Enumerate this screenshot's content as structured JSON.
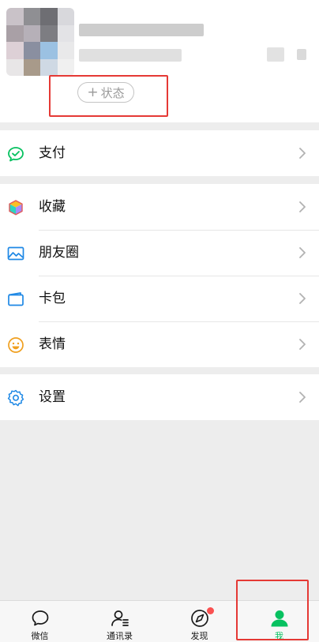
{
  "profile": {
    "status_plus": "+",
    "status_label": "状态"
  },
  "menu": {
    "pay_label": "支付",
    "favorites_label": "收藏",
    "moments_label": "朋友圈",
    "cards_label": "卡包",
    "stickers_label": "表情",
    "settings_label": "设置"
  },
  "tabs": [
    {
      "label": "微信",
      "icon": "chat-bubble-icon",
      "active": false
    },
    {
      "label": "通讯录",
      "icon": "contacts-icon",
      "active": false
    },
    {
      "label": "发现",
      "icon": "compass-icon",
      "active": false,
      "badge_dot": true
    },
    {
      "label": "我",
      "icon": "person-icon",
      "active": true
    }
  ],
  "colors": {
    "accent": "#07c160",
    "badge": "#fa5151",
    "highlight_box": "#e53935",
    "page_bg": "#ededed"
  }
}
